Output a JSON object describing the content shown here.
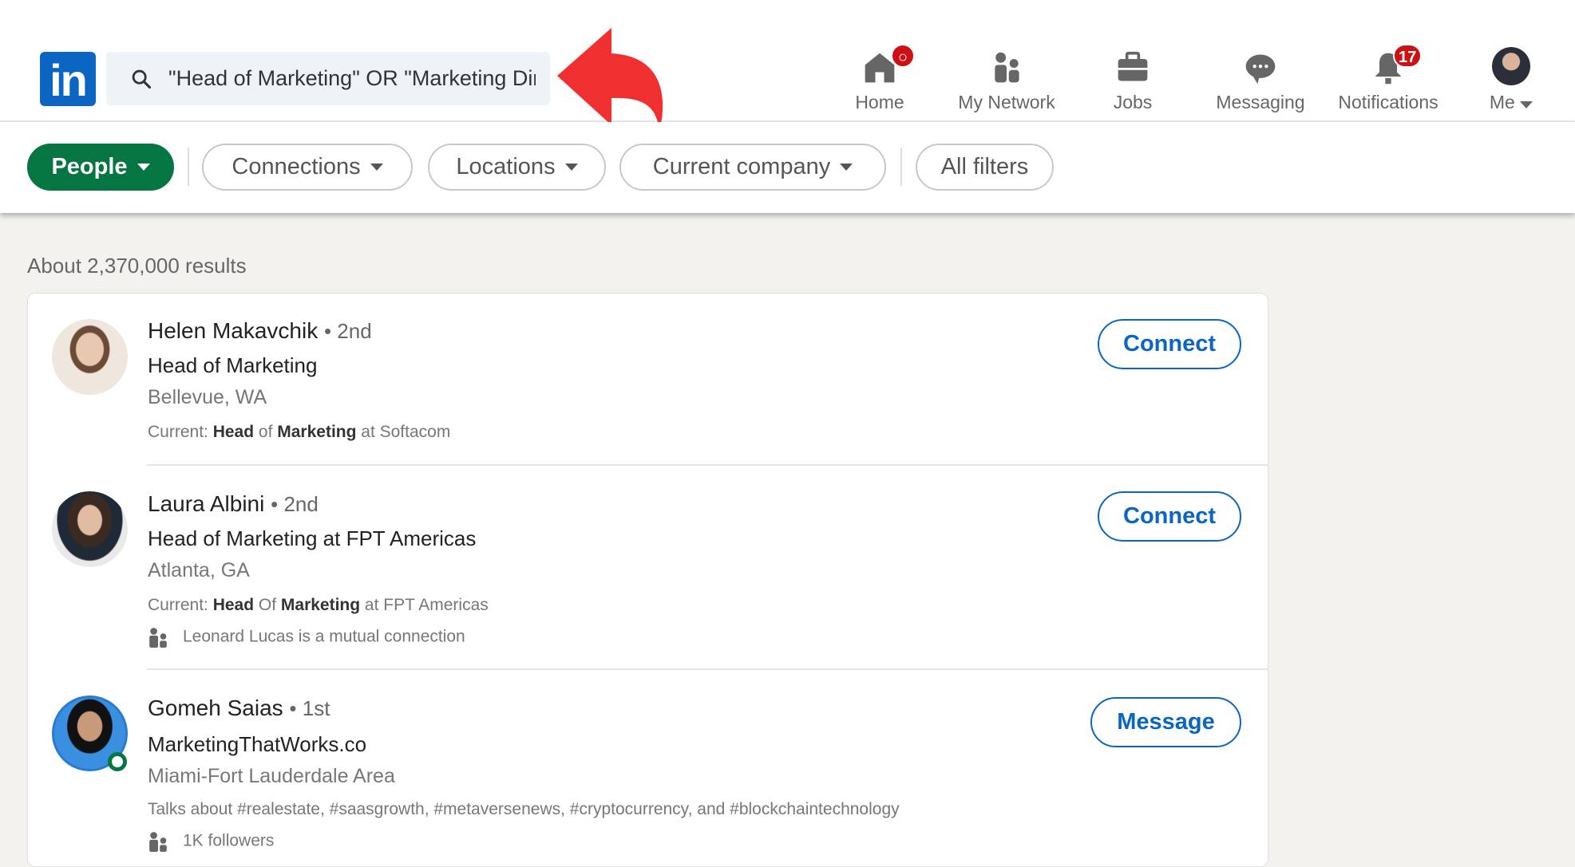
{
  "header": {
    "logo_text": "in",
    "search": {
      "value": "\"Head of Marketing\" OR \"Marketing Director\"",
      "icon": "search-icon"
    },
    "nav": [
      {
        "label": "Home",
        "icon": "home-icon",
        "badge": ""
      },
      {
        "label": "My Network",
        "icon": "people-icon",
        "badge": ""
      },
      {
        "label": "Jobs",
        "icon": "briefcase-icon",
        "badge": ""
      },
      {
        "label": "Messaging",
        "icon": "chat-icon",
        "badge": ""
      },
      {
        "label": "Notifications",
        "icon": "bell-icon",
        "badge": "17"
      },
      {
        "label": "Me",
        "icon": "avatar",
        "badge": ""
      }
    ]
  },
  "filters": [
    {
      "label": "People",
      "active": true
    },
    {
      "label": "Connections"
    },
    {
      "label": "Locations"
    },
    {
      "label": "Current company"
    },
    {
      "label": "All filters"
    }
  ],
  "results_count": "About 2,370,000 results",
  "results": [
    {
      "name": "Helen Makavchik",
      "degree": "• 2nd",
      "headline": "Head of Marketing",
      "location": "Bellevue, WA",
      "current_prefix": "Current: ",
      "current_b1": "Head",
      "current_m": " of ",
      "current_b2": "Marketing",
      "current_s": " at Softacom",
      "action": "Connect"
    },
    {
      "name": "Laura Albini",
      "degree": "• 2nd",
      "headline": "Head of Marketing at FPT Americas",
      "location": "Atlanta, GA",
      "current_prefix": "Current: ",
      "current_b1": "Head",
      "current_m": " Of ",
      "current_b2": "Marketing",
      "current_s": " at FPT Americas",
      "mutual": "Leonard Lucas is a mutual connection",
      "action": "Connect"
    },
    {
      "name": "Gomeh Saias",
      "degree": "• 1st",
      "headline": "MarketingThatWorks.co",
      "location": "Miami-Fort Lauderdale Area",
      "talks": "Talks about #realestate, #saasgrowth, #metaversenews, #cryptocurrency, and #blockchaintechnology",
      "followers": "1K followers",
      "action": "Message"
    }
  ],
  "colors": {
    "brand": "#0a66c2",
    "people_filter": "#057642",
    "badge": "#cc1016",
    "annotation_arrow": "#f03030"
  }
}
